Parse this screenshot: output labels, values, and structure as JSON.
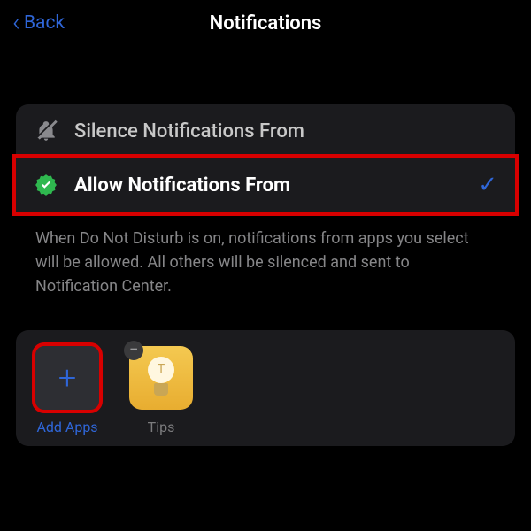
{
  "header": {
    "back_label": "Back",
    "title": "Notifications"
  },
  "options": {
    "silence": {
      "label": "Silence Notifications From"
    },
    "allow": {
      "label": "Allow Notifications From",
      "selected": true
    }
  },
  "description": "When Do Not Disturb is on, notifications from apps you select will be allowed. All others will be silenced and sent to Notification Center.",
  "apps": {
    "add": {
      "label": "Add Apps"
    },
    "items": [
      {
        "label": "Tips",
        "icon": "lightbulb",
        "removable": true
      }
    ]
  },
  "colors": {
    "accent": "#2f66d8",
    "highlight": "#d80000",
    "card_bg": "#1b1b1e"
  }
}
